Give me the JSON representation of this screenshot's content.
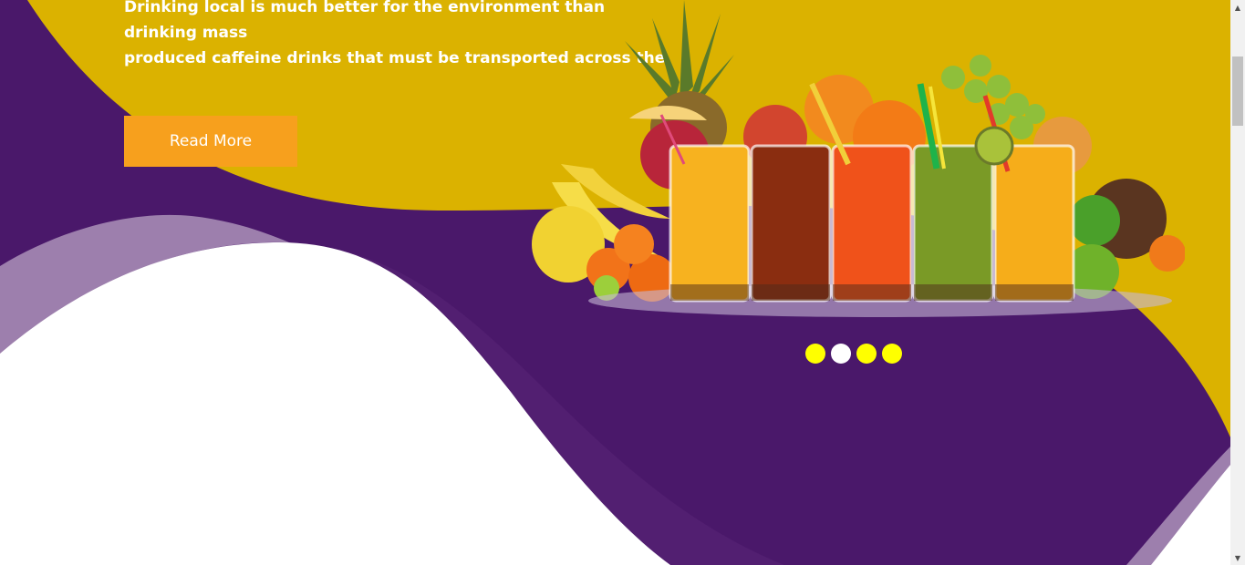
{
  "hero": {
    "description": "Drinking local is much better for the environment than drinking mass\nproduced caffeine drinks that must be transported across the country\nbefore it gets to you.",
    "read_more_label": "Read More"
  },
  "slider": {
    "dots": [
      {
        "state": "inactive"
      },
      {
        "state": "active"
      },
      {
        "state": "inactive"
      },
      {
        "state": "inactive"
      }
    ]
  },
  "colors": {
    "purple": "#4a186a",
    "yellow": "#dbb200",
    "button_orange": "#f7a01d",
    "dot_yellow": "#ffff00",
    "light_purple": "#9d7fad"
  },
  "icons": {
    "image": "fruit-juice-image",
    "scroll_up": "scroll-up-arrow-icon",
    "scroll_down": "scroll-down-arrow-icon"
  }
}
